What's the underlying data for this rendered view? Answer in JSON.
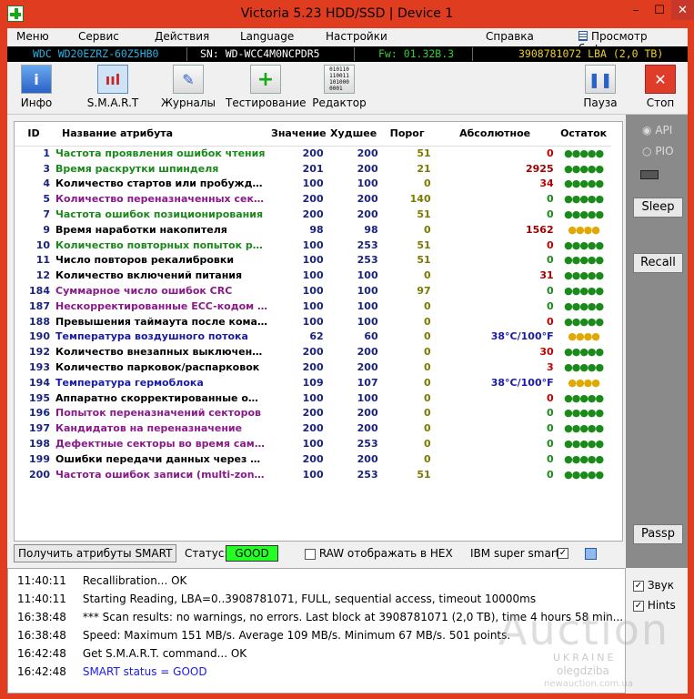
{
  "title": "Victoria 5.23 HDD/SSD | Device 1",
  "window_controls": {
    "min": "–",
    "max": "☐",
    "close": "✕"
  },
  "menu": {
    "items": [
      "Меню",
      "Сервис",
      "Действия",
      "Language",
      "Настройки",
      "Справка"
    ],
    "buffer": "Просмотр буфера"
  },
  "infobar": {
    "model": "WDC WD20EZRZ-60Z5HB0",
    "serial": "SN: WD-WCC4M0NCPDR5",
    "firmware": "Fw: 01.32B.3",
    "capacity": "3908781072 LBA (2,0 TB)"
  },
  "toolbar": {
    "info": "Инфо",
    "smart": "S.M.A.R.T",
    "logs": "Журналы",
    "test": "Тестирование",
    "editor": "Редактор",
    "pause": "Пауза",
    "stop": "Стоп"
  },
  "table": {
    "headers": [
      "ID",
      "Название атрибута",
      "Значение",
      "Худшее",
      "Порог",
      "Абсолютное",
      "Остаток"
    ],
    "rows": [
      {
        "id": "1",
        "name": "Частота проявления ошибок чтения",
        "value": "200",
        "worst": "200",
        "threshold": "51",
        "raw": "0",
        "left": "●●●●●",
        "name_color": "#1a8a1a",
        "raw_color": "#c00000",
        "left_color": "#1a8a1a"
      },
      {
        "id": "3",
        "name": "Время раскрутки шпинделя",
        "value": "201",
        "worst": "200",
        "threshold": "21",
        "raw": "2925",
        "left": "●●●●●",
        "name_color": "#1a8a1a",
        "raw_color": "#a00000",
        "left_color": "#1a8a1a"
      },
      {
        "id": "4",
        "name": "Количество стартов или пробуждений",
        "value": "100",
        "worst": "100",
        "threshold": "0",
        "raw": "34",
        "left": "●●●●●",
        "name_color": "#000000",
        "raw_color": "#c00000",
        "left_color": "#1a8a1a"
      },
      {
        "id": "5",
        "name": "Количество переназначенных сектор…",
        "value": "200",
        "worst": "200",
        "threshold": "140",
        "raw": "0",
        "left": "●●●●●",
        "name_color": "#8a1a8a",
        "raw_color": "#1a8a1a",
        "left_color": "#1a8a1a"
      },
      {
        "id": "7",
        "name": "Частота ошибок позиционирования",
        "value": "200",
        "worst": "200",
        "threshold": "51",
        "raw": "0",
        "left": "●●●●●",
        "name_color": "#1a8a1a",
        "raw_color": "#1a8a1a",
        "left_color": "#1a8a1a"
      },
      {
        "id": "9",
        "name": "Время наработки накопителя",
        "value": "98",
        "worst": "98",
        "threshold": "0",
        "raw": "1562",
        "left": "●●●●",
        "name_color": "#000000",
        "raw_color": "#a00000",
        "left_color": "#e0a800"
      },
      {
        "id": "10",
        "name": "Количество повторных попыток раск…",
        "value": "100",
        "worst": "253",
        "threshold": "51",
        "raw": "0",
        "left": "●●●●●",
        "name_color": "#1a8a1a",
        "raw_color": "#c00000",
        "left_color": "#1a8a1a"
      },
      {
        "id": "11",
        "name": "Число повторов рекалибровки",
        "value": "100",
        "worst": "253",
        "threshold": "51",
        "raw": "0",
        "left": "●●●●●",
        "name_color": "#000000",
        "raw_color": "#1a8a1a",
        "left_color": "#1a8a1a"
      },
      {
        "id": "12",
        "name": "Количество включений питания",
        "value": "100",
        "worst": "100",
        "threshold": "0",
        "raw": "31",
        "left": "●●●●●",
        "name_color": "#000000",
        "raw_color": "#a00000",
        "left_color": "#1a8a1a"
      },
      {
        "id": "184",
        "name": "Суммарное число ошибок CRC",
        "value": "100",
        "worst": "100",
        "threshold": "97",
        "raw": "0",
        "left": "●●●●●",
        "name_color": "#8a1a8a",
        "raw_color": "#1a8a1a",
        "left_color": "#1a8a1a"
      },
      {
        "id": "187",
        "name": "Нескорректированные ECC-кодом ош…",
        "value": "100",
        "worst": "100",
        "threshold": "0",
        "raw": "0",
        "left": "●●●●●",
        "name_color": "#8a1a8a",
        "raw_color": "#1a8a1a",
        "left_color": "#1a8a1a"
      },
      {
        "id": "188",
        "name": "Превышения таймаута после команды",
        "value": "100",
        "worst": "100",
        "threshold": "0",
        "raw": "0",
        "left": "●●●●●",
        "name_color": "#000000",
        "raw_color": "#c00000",
        "left_color": "#1a8a1a"
      },
      {
        "id": "190",
        "name": "Температура воздушного потока",
        "value": "62",
        "worst": "60",
        "threshold": "0",
        "raw": "38°C/100°F",
        "left": "●●●●",
        "name_color": "#1a1aaa",
        "raw_color": "#1a1aaa",
        "left_color": "#e0a800"
      },
      {
        "id": "192",
        "name": "Количество внезапных выключений п…",
        "value": "200",
        "worst": "200",
        "threshold": "0",
        "raw": "30",
        "left": "●●●●●",
        "name_color": "#000000",
        "raw_color": "#c00000",
        "left_color": "#1a8a1a"
      },
      {
        "id": "193",
        "name": "Количество парковок/распарковок",
        "value": "200",
        "worst": "200",
        "threshold": "0",
        "raw": "3",
        "left": "●●●●●",
        "name_color": "#000000",
        "raw_color": "#c00000",
        "left_color": "#1a8a1a"
      },
      {
        "id": "194",
        "name": "Температура гермоблока",
        "value": "109",
        "worst": "107",
        "threshold": "0",
        "raw": "38°C/100°F",
        "left": "●●●●",
        "name_color": "#1a1aaa",
        "raw_color": "#1a1aaa",
        "left_color": "#e0a800"
      },
      {
        "id": "195",
        "name": "Аппаратно скорректированные ошибки",
        "value": "100",
        "worst": "100",
        "threshold": "0",
        "raw": "0",
        "left": "●●●●●",
        "name_color": "#000000",
        "raw_color": "#c00000",
        "left_color": "#1a8a1a"
      },
      {
        "id": "196",
        "name": "Попыток переназначений секторов",
        "value": "200",
        "worst": "200",
        "threshold": "0",
        "raw": "0",
        "left": "●●●●●",
        "name_color": "#8a1a8a",
        "raw_color": "#1a8a1a",
        "left_color": "#1a8a1a"
      },
      {
        "id": "197",
        "name": "Кандидатов на переназначение",
        "value": "200",
        "worst": "200",
        "threshold": "0",
        "raw": "0",
        "left": "●●●●●",
        "name_color": "#8a1a8a",
        "raw_color": "#1a8a1a",
        "left_color": "#1a8a1a"
      },
      {
        "id": "198",
        "name": "Дефектные секторы во время самот…",
        "value": "100",
        "worst": "253",
        "threshold": "0",
        "raw": "0",
        "left": "●●●●●",
        "name_color": "#8a1a8a",
        "raw_color": "#1a8a1a",
        "left_color": "#1a8a1a"
      },
      {
        "id": "199",
        "name": "Ошибки передачи данных через DMA",
        "value": "200",
        "worst": "200",
        "threshold": "0",
        "raw": "0",
        "left": "●●●●●",
        "name_color": "#000000",
        "raw_color": "#1a8a1a",
        "left_color": "#1a8a1a"
      },
      {
        "id": "200",
        "name": "Частота ошибок записи (multi-zone err…",
        "value": "100",
        "worst": "253",
        "threshold": "51",
        "raw": "0",
        "left": "●●●●●",
        "name_color": "#8a1a8a",
        "raw_color": "#1a8a1a",
        "left_color": "#1a8a1a"
      }
    ]
  },
  "right_panel": {
    "api": "API",
    "pio": "PIO",
    "sleep": "Sleep",
    "recall": "Recall",
    "passp": "Passp"
  },
  "status_row": {
    "get_smart": "Получить атрибуты SMART",
    "status_label": "Статус:",
    "status_value": "GOOD",
    "raw_hex": "RAW отображать в HEX",
    "ibm": "IBM super smart:"
  },
  "log": [
    {
      "time": "11:40:11",
      "text": "Recallibration... OK",
      "color": "#000000"
    },
    {
      "time": "11:40:11",
      "text": "Starting Reading, LBA=0..3908781071, FULL, sequential access, timeout 10000ms",
      "color": "#000000"
    },
    {
      "time": "16:38:48",
      "text": "*** Scan results: no warnings, no errors. Last block at 3908781071 (2,0 TB), time 4 hours 58 min...",
      "color": "#000000"
    },
    {
      "time": "16:38:48",
      "text": "Speed: Maximum 151 MB/s. Average 109 MB/s. Minimum 67 MB/s. 501 points.",
      "color": "#000000"
    },
    {
      "time": "16:42:48",
      "text": "Get S.M.A.R.T. command... OK",
      "color": "#000000"
    },
    {
      "time": "16:42:48",
      "text": "SMART status = GOOD",
      "color": "#1a1aee"
    }
  ],
  "log_options": {
    "sound": "Звук",
    "hints": "Hints"
  },
  "watermark": {
    "main": "Auction",
    "sub": "UKRAINE",
    "user": "olegdziba",
    "site": "newauction.com.ua"
  }
}
